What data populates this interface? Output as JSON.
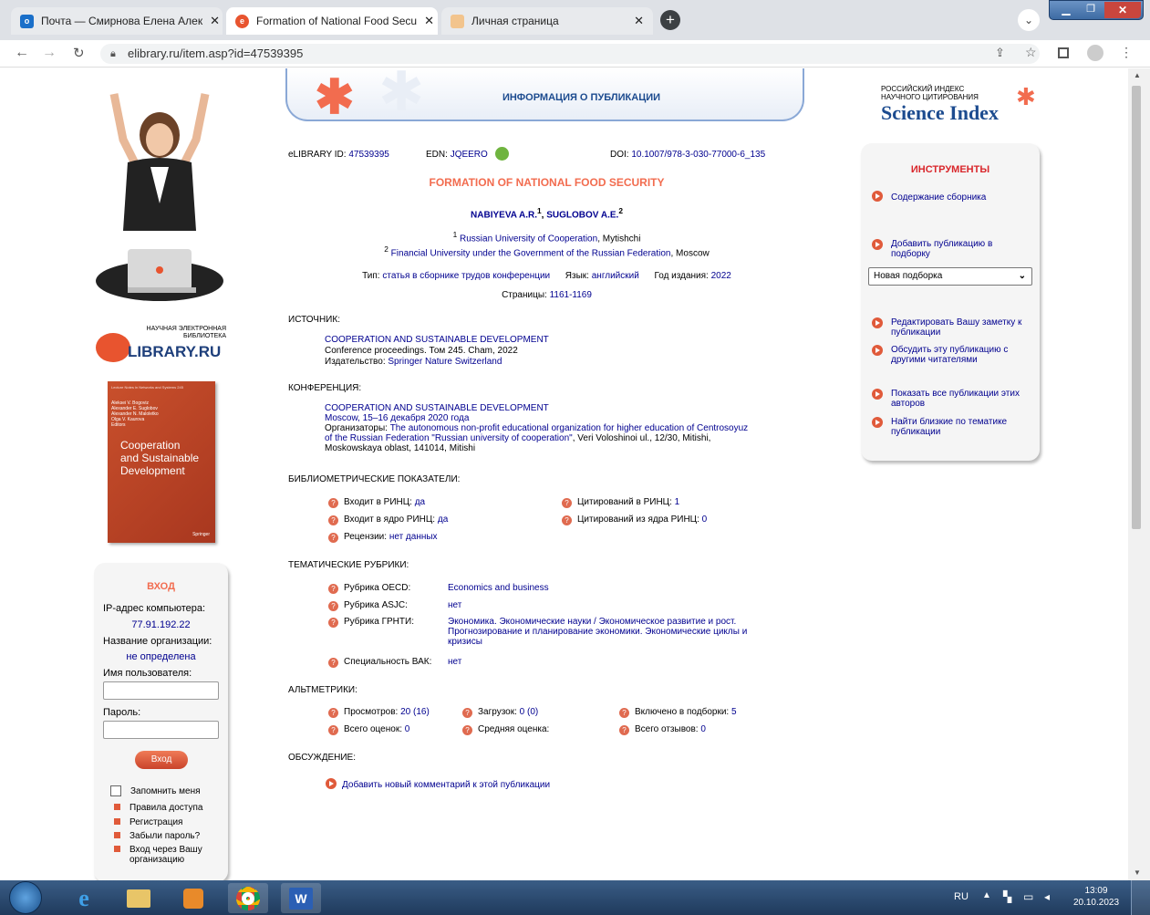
{
  "browser": {
    "tabs": [
      {
        "title": "Почта — Смирнова Елена Алек",
        "close": "✕"
      },
      {
        "title": "Formation of National Food Secu",
        "close": "✕"
      },
      {
        "title": "Личная страница",
        "close": "✕"
      }
    ],
    "new_tab": "+",
    "url": "elibrary.ru/item.asp?id=47539395"
  },
  "header": {
    "banner_title": "ИНФОРМАЦИЯ О ПУБЛИКАЦИИ",
    "si_line1": "РОССИЙСКИЙ ИНДЕКС",
    "si_line2": "НАУЧНОГО ЦИТИРОВАНИЯ",
    "si_title": "Science Index"
  },
  "logo": {
    "line1": "НАУЧНАЯ ЭЛЕКТРОННАЯ",
    "line2": "БИБЛИОТЕКА",
    "name": "LIBRARY.RU"
  },
  "cover": {
    "series": "Lecture Notes in Networks and Systems 245",
    "editors": [
      "Aleksei V. Bogoviz",
      "Alexander E. Suglobov",
      "Alexander N. Maloletko",
      "Olga V. Kaurova",
      "Editors"
    ],
    "title_lines": [
      "Cooperation",
      "and Sustainable",
      "Development"
    ],
    "publisher": "Springer"
  },
  "ids": {
    "elibrary_label": "eLIBRARY ID:",
    "elibrary_id": "47539395",
    "edn_label": "EDN:",
    "edn": "JQEERO",
    "doi_label": "DOI:",
    "doi": "10.1007/978-3-030-77000-6_135"
  },
  "article": {
    "title": "FORMATION OF NATIONAL FOOD SECURITY",
    "author1": "NABIYEVA A.R.",
    "author1_sup": "1",
    "sep": ", ",
    "author2": "SUGLOBOV A.E.",
    "author2_sup": "2",
    "aff1_sup": "1",
    "aff1_org": "Russian University of Cooperation",
    "aff1_city": ", Mytishchi",
    "aff2_sup": "2",
    "aff2_org": "Financial University under the Government of the Russian Federation",
    "aff2_city": ", Moscow",
    "type_label": "Тип:",
    "type": "статья в сборнике трудов конференции",
    "lang_label": "Язык:",
    "lang": "английский",
    "year_label": "Год издания:",
    "year": "2022",
    "pages_label": "Страницы:",
    "pages": "1161-1169"
  },
  "source": {
    "heading": "ИСТОЧНИК:",
    "title": "COOPERATION AND SUSTAINABLE DEVELOPMENT",
    "line2": "Conference proceedings. Том 245. Cham, 2022",
    "publisher_label": "Издательство:",
    "publisher": "Springer Nature Switzerland"
  },
  "conference": {
    "heading": "КОНФЕРЕНЦИЯ:",
    "title": "COOPERATION AND SUSTAINABLE DEVELOPMENT",
    "date": "Moscow, 15–16 декабря 2020 года",
    "org_label": "Организаторы:",
    "org_line1": "The autonomous non-profit educational organization for higher education of Centrosoyuz",
    "org_line2": "of the Russian Federation \"Russian university of cooperation\"",
    "org_tail": ", Veri Voloshinoi ul., 12/30, Mitishi,",
    "org_line3": "Moskowskaya oblast, 141014, Mitishi"
  },
  "biblio": {
    "heading": "БИБЛИОМЕТРИЧЕСКИЕ ПОКАЗАТЕЛИ:",
    "rinc_label": "Входит в РИНЦ:",
    "rinc": "да",
    "core_label": "Входит в ядро РИНЦ:",
    "core": "да",
    "reviews_label": "Рецензии:",
    "reviews": "нет данных",
    "cit_label": "Цитирований в РИНЦ:",
    "cit": "1",
    "cit_core_label": "Цитирований из ядра РИНЦ:",
    "cit_core": "0"
  },
  "rubrics": {
    "heading": "ТЕМАТИЧЕСКИЕ РУБРИКИ:",
    "oecd_label": "Рубрика OECD:",
    "oecd": "Economics and business",
    "asjc_label": "Рубрика ASJC:",
    "asjc": "нет",
    "grnti_label": "Рубрика ГРНТИ:",
    "grnti_line1": "Экономика. Экономические науки / Экономическое развитие и рост.",
    "grnti_line2": "Прогнозирование и планирование экономики. Экономические циклы и",
    "grnti_line3": "кризисы",
    "vak_label": "Специальность ВАК:",
    "vak": "нет"
  },
  "altmetrics": {
    "heading": "АЛЬТМЕТРИКИ:",
    "views_label": "Просмотров:",
    "views": "20 (16)",
    "downloads_label": "Загрузок:",
    "downloads": "0 (0)",
    "collections_label": "Включено в подборки:",
    "collections": "5",
    "ratings_label": "Всего оценок:",
    "ratings": "0",
    "avg_label": "Средняя оценка:",
    "avg": "",
    "reviews_label": "Всего отзывов:",
    "reviews": "0"
  },
  "discussion": {
    "heading": "ОБСУЖДЕНИЕ:",
    "add_comment": "Добавить новый комментарий к этой публикации"
  },
  "tools": {
    "heading": "ИНСТРУМЕНТЫ",
    "contents": "Содержание сборника",
    "add_line1": "Добавить публикацию в",
    "add_line2": "подборку",
    "select_value": "Новая подборка",
    "edit_line1": "Редактировать Вашу заметку к",
    "edit_line2": "публикации",
    "discuss_line1": "Обсудить эту публикацию с",
    "discuss_line2": "другими читателями",
    "show_line1": "Показать все публикации этих",
    "show_line2": "авторов",
    "similar_line1": "Найти близкие по тематике",
    "similar_line2": "публикации"
  },
  "login": {
    "heading": "ВХОД",
    "ip_label": "IP-адрес компьютера:",
    "ip": "77.91.192.22",
    "org_label": "Название организации:",
    "org": "не определена",
    "user_label": "Имя пользователя:",
    "pass_label": "Пароль:",
    "button": "Вход",
    "remember": "Запомнить меня",
    "rules": "Правила доступа",
    "register": "Регистрация",
    "forgot": "Забыли пароль?",
    "via_org_line1": "Вход через Вашу",
    "via_org_line2": "организацию"
  },
  "taskbar": {
    "lang": "RU",
    "time": "13:09",
    "date": "20.10.2023"
  },
  "colors": {
    "accent": "#f26c4f",
    "link": "#00008f",
    "tools_heading": "#d9262b"
  }
}
